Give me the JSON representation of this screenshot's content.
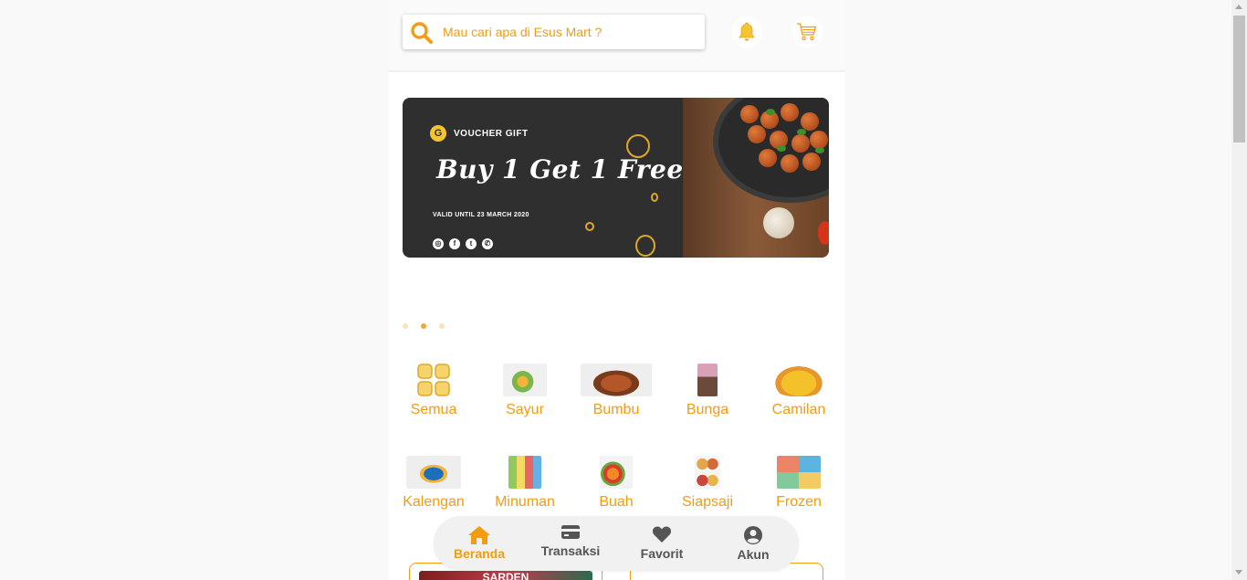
{
  "search": {
    "placeholder": "Mau cari apa di Esus Mart ?",
    "value": ""
  },
  "header": {
    "bell_icon": "bell-icon",
    "cart_icon": "cart-icon"
  },
  "banner": {
    "voucher_label": "VOUCHER GIFT",
    "headline": "Buy 1 Get 1 Free",
    "valid": "VALID UNTIL 23 MARCH 2020",
    "socials": [
      "instagram-icon",
      "facebook-icon",
      "twitter-icon",
      "whatsapp-icon"
    ]
  },
  "carousel": {
    "total": 3,
    "active_index": 1
  },
  "categories_row1": [
    {
      "label": "Semua",
      "icon": "grid-icon"
    },
    {
      "label": "Sayur",
      "icon": "vegetable-image"
    },
    {
      "label": "Bumbu",
      "icon": "spice-image"
    },
    {
      "label": "Bunga",
      "icon": "flower-image"
    },
    {
      "label": "Camilan",
      "icon": "snack-image"
    }
  ],
  "categories_row2": [
    {
      "label": "Kalengan",
      "icon": "can-image"
    },
    {
      "label": "Minuman",
      "icon": "drink-image"
    },
    {
      "label": "Buah",
      "icon": "fruit-image"
    },
    {
      "label": "Siapsaji",
      "icon": "ready-meal-image"
    },
    {
      "label": "Frozen",
      "icon": "frozen-image"
    }
  ],
  "bottom_nav": [
    {
      "label": "Beranda",
      "icon": "home-icon",
      "active": true
    },
    {
      "label": "Transaksi",
      "icon": "wallet-icon",
      "active": false
    },
    {
      "label": "Favorit",
      "icon": "heart-icon",
      "active": false
    },
    {
      "label": "Akun",
      "icon": "account-icon",
      "active": false
    }
  ],
  "product_preview": {
    "thumb_text": "SARDEN"
  },
  "colors": {
    "accent": "#f39c12",
    "bell": "#f6c431",
    "banner_bg": "#2f2f2f"
  }
}
